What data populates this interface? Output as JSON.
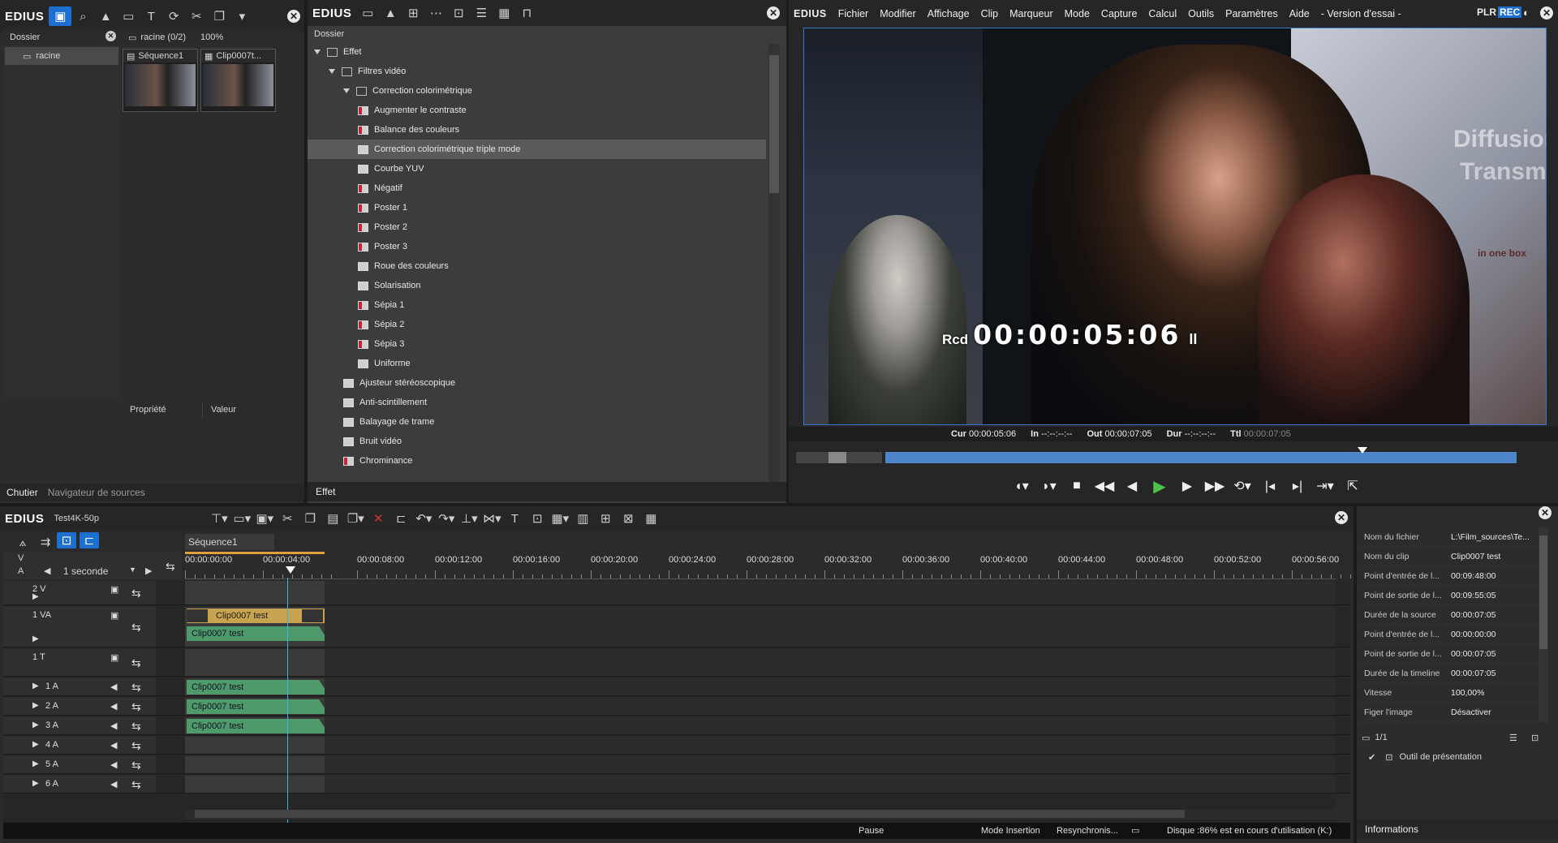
{
  "app_name": "EDIUS",
  "bin": {
    "folder_header": "Dossier",
    "root_folder": "racine",
    "path_label": "racine (0/2)",
    "zoom": "100%",
    "clips": [
      {
        "name": "Séquence1"
      },
      {
        "name": "Clip0007t..."
      }
    ],
    "prop_headers": [
      "Propriété",
      "Valeur"
    ],
    "tabs": [
      "Chutier",
      "Navigateur de sources"
    ]
  },
  "effects": {
    "folder_header": "Dossier",
    "tab": "Effet",
    "items": [
      {
        "label": "Effet",
        "indent": 0,
        "type": "folder",
        "expanded": true
      },
      {
        "label": "Filtres vidéo",
        "indent": 1,
        "type": "folder",
        "expanded": true
      },
      {
        "label": "Correction colorimétrique",
        "indent": 2,
        "type": "folder",
        "expanded": true
      },
      {
        "label": "Augmenter le contraste",
        "indent": 3,
        "type": "fx-red"
      },
      {
        "label": "Balance des couleurs",
        "indent": 3,
        "type": "fx-red"
      },
      {
        "label": "Correction colorimétrique triple mode",
        "indent": 3,
        "type": "fx",
        "selected": true
      },
      {
        "label": "Courbe YUV",
        "indent": 3,
        "type": "fx"
      },
      {
        "label": "Négatif",
        "indent": 3,
        "type": "fx-red"
      },
      {
        "label": "Poster 1",
        "indent": 3,
        "type": "fx-red"
      },
      {
        "label": "Poster 2",
        "indent": 3,
        "type": "fx-red"
      },
      {
        "label": "Poster 3",
        "indent": 3,
        "type": "fx-red"
      },
      {
        "label": "Roue des couleurs",
        "indent": 3,
        "type": "fx"
      },
      {
        "label": "Solarisation",
        "indent": 3,
        "type": "fx"
      },
      {
        "label": "Sépia 1",
        "indent": 3,
        "type": "fx-red"
      },
      {
        "label": "Sépia 2",
        "indent": 3,
        "type": "fx-red"
      },
      {
        "label": "Sépia 3",
        "indent": 3,
        "type": "fx-red"
      },
      {
        "label": "Uniforme",
        "indent": 3,
        "type": "fx"
      },
      {
        "label": "Ajusteur stéréoscopique",
        "indent": 2,
        "type": "fx"
      },
      {
        "label": "Anti-scintillement",
        "indent": 2,
        "type": "fx"
      },
      {
        "label": "Balayage de trame",
        "indent": 2,
        "type": "fx"
      },
      {
        "label": "Bruit vidéo",
        "indent": 2,
        "type": "fx"
      },
      {
        "label": "Chrominance",
        "indent": 2,
        "type": "fx-red"
      }
    ]
  },
  "player": {
    "menu": [
      "Fichier",
      "Modifier",
      "Affichage",
      "Clip",
      "Marqueur",
      "Mode",
      "Capture",
      "Calcul",
      "Outils",
      "Paramètres",
      "Aide",
      "- Version d'essai -"
    ],
    "plr": "PLR",
    "rec": "REC",
    "overlay_prefix": "Rcd",
    "overlay_tc": "00:00:05:06",
    "overlay_pause": "II",
    "timecodes": [
      {
        "k": "Cur",
        "v": "00:00:05:06"
      },
      {
        "k": "In",
        "v": "--:--:--:--"
      },
      {
        "k": "Out",
        "v": "00:00:07:05"
      },
      {
        "k": "Dur",
        "v": "--:--:--:--"
      },
      {
        "k": "Ttl",
        "v": "00:00:07:05"
      }
    ],
    "video_text": [
      "Diffusion",
      "Transmi",
      "in one box"
    ]
  },
  "timeline": {
    "project": "Test4K-50p",
    "sequence_tab": "Séquence1",
    "scale": "1 seconde",
    "ruler": [
      "00:00:00:00",
      "00:00:04:00",
      "00:00:08:00",
      "00:00:12:00",
      "00:00:16:00",
      "00:00:20:00",
      "00:00:24:00",
      "00:00:28:00",
      "00:00:32:00",
      "00:00:36:00",
      "00:00:40:00",
      "00:00:44:00",
      "00:00:48:00",
      "00:00:52:00",
      "00:00:56:00"
    ],
    "va_labels": [
      "V",
      "A"
    ],
    "tracks": [
      {
        "name": "2 V"
      },
      {
        "name": "1 VA"
      },
      {
        "name": "1 T"
      },
      {
        "name": "1 A"
      },
      {
        "name": "2 A"
      },
      {
        "name": "3 A"
      },
      {
        "name": "4 A"
      },
      {
        "name": "5 A"
      },
      {
        "name": "6 A"
      }
    ],
    "clip_name": "Clip0007 test"
  },
  "info": {
    "rows": [
      {
        "k": "Nom du fichier",
        "v": "L:\\Film_sources\\Te..."
      },
      {
        "k": "Nom du clip",
        "v": "Clip0007 test"
      },
      {
        "k": "Point d'entrée de l...",
        "v": "00:09:48:00"
      },
      {
        "k": "Point de sortie de l...",
        "v": "00:09:55:05"
      },
      {
        "k": "Durée de la source",
        "v": "00:00:07:05"
      },
      {
        "k": "Point d'entrée de l...",
        "v": "00:00:00:00"
      },
      {
        "k": "Point de sortie de l...",
        "v": "00:00:07:05"
      },
      {
        "k": "Durée de la timeline",
        "v": "00:00:07:05"
      },
      {
        "k": "Vitesse",
        "v": "100,00%"
      },
      {
        "k": "Figer l'image",
        "v": "Désactiver"
      }
    ],
    "page": "1/1",
    "tool": "Outil de présentation",
    "tab": "Informations"
  },
  "status": {
    "pause": "Pause",
    "mode": "Mode Insertion",
    "resync": "Resynchronis...",
    "disk": "Disque :86% est en cours d'utilisation (K:)"
  }
}
